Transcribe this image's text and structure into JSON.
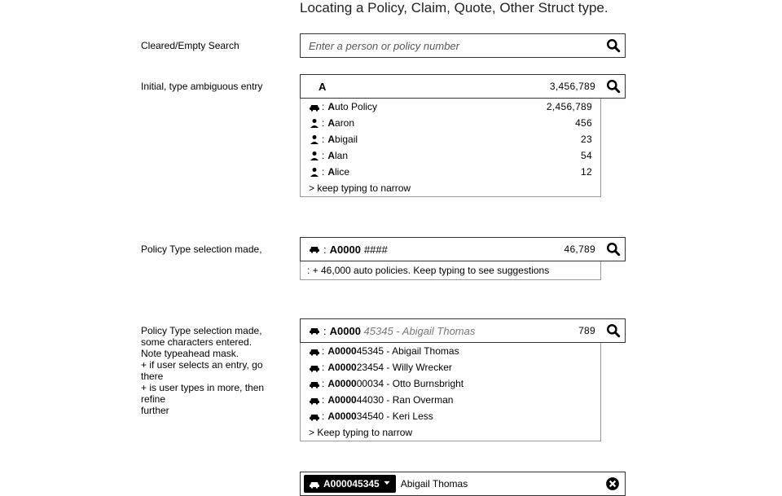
{
  "title": "Locating a Policy, Claim, Quote, Other Struct type.",
  "stateLabels": {
    "empty": "Cleared/Empty Search",
    "ambiguous": "Initial, type ambiguous  entry",
    "policyType": "Policy Type selection made,",
    "policyTypePartial": "Policy Type selection made,\nsome characters entered.\nNote typeahead mask.\n+ if user selects an entry, go there\n+ is user types in more, then refine\n    further"
  },
  "emptySearch": {
    "placeholder": "Enter a person or policy number"
  },
  "ambiguous": {
    "typed": "A",
    "totalCount": "3,456,789",
    "items": [
      {
        "icon": "car",
        "bold": "A",
        "rest": "uto Policy",
        "count": "2,456,789"
      },
      {
        "icon": "person",
        "bold": "A",
        "rest": "aron",
        "count": "456"
      },
      {
        "icon": "person",
        "bold": "A",
        "rest": "bigail",
        "count": "23"
      },
      {
        "icon": "person",
        "bold": "A",
        "rest": "lan",
        "count": "54"
      },
      {
        "icon": "person",
        "bold": "A",
        "rest": "lice",
        "count": "12"
      }
    ],
    "hint": "> keep typing to narrow"
  },
  "policyType": {
    "prefixBold": "A0000",
    "mask": " ####",
    "count": "46,789",
    "hint": ": + 46,000 auto policies.  Keep typing to see suggestions"
  },
  "policyPartial": {
    "prefixBold": "A0000",
    "ghost": " 45345 - Abigail Thomas",
    "count": "789",
    "items": [
      {
        "bold": "A0000",
        "rest": "45345  - Abigail Thomas"
      },
      {
        "bold": "A0000",
        "rest": "23454 - Willy Wrecker"
      },
      {
        "bold": "A0000",
        "rest": "00034 - Otto Burnsbright"
      },
      {
        "bold": "A0000",
        "rest": "44030 - Ran Overman"
      },
      {
        "bold": "A0000",
        "rest": "34540 - Keri Less"
      }
    ],
    "hint": "> Keep typing to narrow"
  },
  "selected": {
    "chipLabel": "A000045345",
    "name": "Abigail Thomas"
  }
}
